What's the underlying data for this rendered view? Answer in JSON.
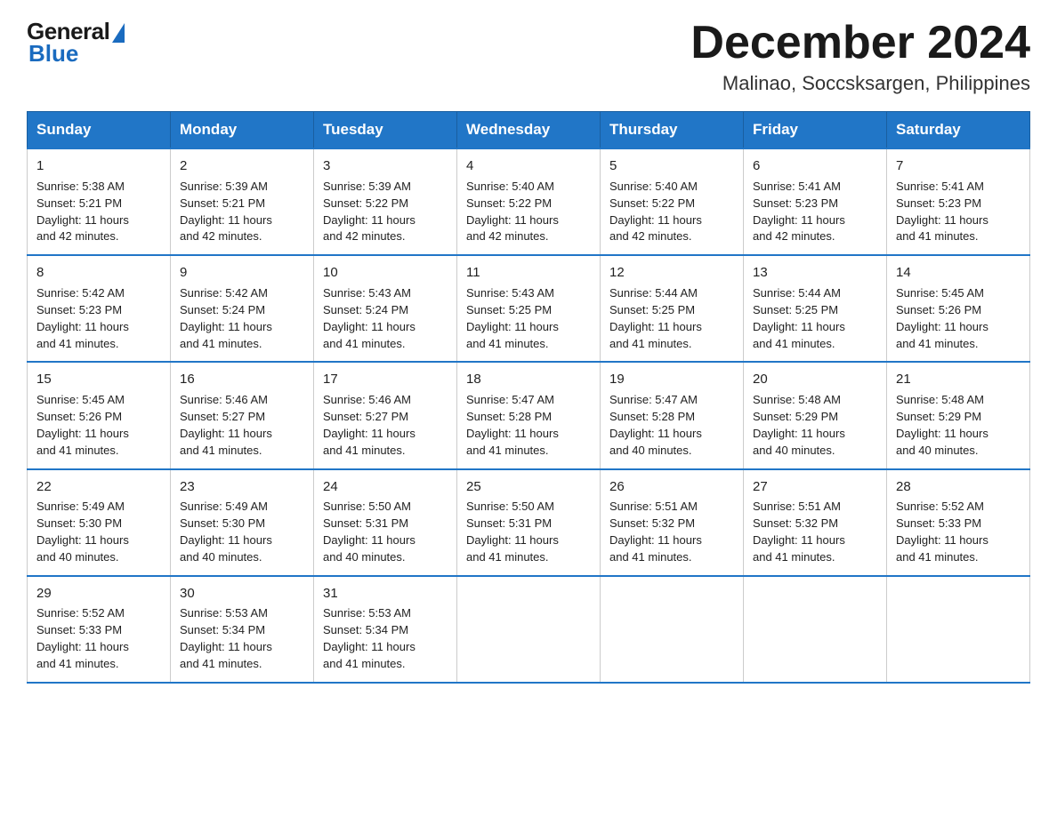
{
  "header": {
    "logo_general": "General",
    "logo_blue": "Blue",
    "month_title": "December 2024",
    "location": "Malinao, Soccsksargen, Philippines"
  },
  "days_of_week": [
    "Sunday",
    "Monday",
    "Tuesday",
    "Wednesday",
    "Thursday",
    "Friday",
    "Saturday"
  ],
  "weeks": [
    [
      {
        "day": "1",
        "sunrise": "5:38 AM",
        "sunset": "5:21 PM",
        "daylight": "11 hours and 42 minutes."
      },
      {
        "day": "2",
        "sunrise": "5:39 AM",
        "sunset": "5:21 PM",
        "daylight": "11 hours and 42 minutes."
      },
      {
        "day": "3",
        "sunrise": "5:39 AM",
        "sunset": "5:22 PM",
        "daylight": "11 hours and 42 minutes."
      },
      {
        "day": "4",
        "sunrise": "5:40 AM",
        "sunset": "5:22 PM",
        "daylight": "11 hours and 42 minutes."
      },
      {
        "day": "5",
        "sunrise": "5:40 AM",
        "sunset": "5:22 PM",
        "daylight": "11 hours and 42 minutes."
      },
      {
        "day": "6",
        "sunrise": "5:41 AM",
        "sunset": "5:23 PM",
        "daylight": "11 hours and 42 minutes."
      },
      {
        "day": "7",
        "sunrise": "5:41 AM",
        "sunset": "5:23 PM",
        "daylight": "11 hours and 41 minutes."
      }
    ],
    [
      {
        "day": "8",
        "sunrise": "5:42 AM",
        "sunset": "5:23 PM",
        "daylight": "11 hours and 41 minutes."
      },
      {
        "day": "9",
        "sunrise": "5:42 AM",
        "sunset": "5:24 PM",
        "daylight": "11 hours and 41 minutes."
      },
      {
        "day": "10",
        "sunrise": "5:43 AM",
        "sunset": "5:24 PM",
        "daylight": "11 hours and 41 minutes."
      },
      {
        "day": "11",
        "sunrise": "5:43 AM",
        "sunset": "5:25 PM",
        "daylight": "11 hours and 41 minutes."
      },
      {
        "day": "12",
        "sunrise": "5:44 AM",
        "sunset": "5:25 PM",
        "daylight": "11 hours and 41 minutes."
      },
      {
        "day": "13",
        "sunrise": "5:44 AM",
        "sunset": "5:25 PM",
        "daylight": "11 hours and 41 minutes."
      },
      {
        "day": "14",
        "sunrise": "5:45 AM",
        "sunset": "5:26 PM",
        "daylight": "11 hours and 41 minutes."
      }
    ],
    [
      {
        "day": "15",
        "sunrise": "5:45 AM",
        "sunset": "5:26 PM",
        "daylight": "11 hours and 41 minutes."
      },
      {
        "day": "16",
        "sunrise": "5:46 AM",
        "sunset": "5:27 PM",
        "daylight": "11 hours and 41 minutes."
      },
      {
        "day": "17",
        "sunrise": "5:46 AM",
        "sunset": "5:27 PM",
        "daylight": "11 hours and 41 minutes."
      },
      {
        "day": "18",
        "sunrise": "5:47 AM",
        "sunset": "5:28 PM",
        "daylight": "11 hours and 41 minutes."
      },
      {
        "day": "19",
        "sunrise": "5:47 AM",
        "sunset": "5:28 PM",
        "daylight": "11 hours and 40 minutes."
      },
      {
        "day": "20",
        "sunrise": "5:48 AM",
        "sunset": "5:29 PM",
        "daylight": "11 hours and 40 minutes."
      },
      {
        "day": "21",
        "sunrise": "5:48 AM",
        "sunset": "5:29 PM",
        "daylight": "11 hours and 40 minutes."
      }
    ],
    [
      {
        "day": "22",
        "sunrise": "5:49 AM",
        "sunset": "5:30 PM",
        "daylight": "11 hours and 40 minutes."
      },
      {
        "day": "23",
        "sunrise": "5:49 AM",
        "sunset": "5:30 PM",
        "daylight": "11 hours and 40 minutes."
      },
      {
        "day": "24",
        "sunrise": "5:50 AM",
        "sunset": "5:31 PM",
        "daylight": "11 hours and 40 minutes."
      },
      {
        "day": "25",
        "sunrise": "5:50 AM",
        "sunset": "5:31 PM",
        "daylight": "11 hours and 41 minutes."
      },
      {
        "day": "26",
        "sunrise": "5:51 AM",
        "sunset": "5:32 PM",
        "daylight": "11 hours and 41 minutes."
      },
      {
        "day": "27",
        "sunrise": "5:51 AM",
        "sunset": "5:32 PM",
        "daylight": "11 hours and 41 minutes."
      },
      {
        "day": "28",
        "sunrise": "5:52 AM",
        "sunset": "5:33 PM",
        "daylight": "11 hours and 41 minutes."
      }
    ],
    [
      {
        "day": "29",
        "sunrise": "5:52 AM",
        "sunset": "5:33 PM",
        "daylight": "11 hours and 41 minutes."
      },
      {
        "day": "30",
        "sunrise": "5:53 AM",
        "sunset": "5:34 PM",
        "daylight": "11 hours and 41 minutes."
      },
      {
        "day": "31",
        "sunrise": "5:53 AM",
        "sunset": "5:34 PM",
        "daylight": "11 hours and 41 minutes."
      },
      null,
      null,
      null,
      null
    ]
  ],
  "labels": {
    "sunrise": "Sunrise:",
    "sunset": "Sunset:",
    "daylight": "Daylight:"
  }
}
